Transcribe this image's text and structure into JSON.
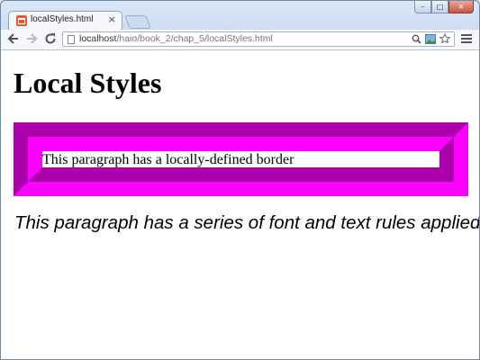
{
  "browser": {
    "tab_title": "localStyles.html",
    "tab_close": "×",
    "url_host": "localhost",
    "url_path": "/haio/book_2/chap_5/localStyles.html",
    "window_buttons": [
      "–",
      "□",
      "✕"
    ]
  },
  "page": {
    "heading": "Local Styles",
    "border_paragraph": "This paragraph has a locally-defined border",
    "styled_paragraph": "This paragraph has a series of font and text rules applied."
  },
  "colors": {
    "border_dark": "#aa00aa",
    "border_light": "#ff00ff"
  }
}
